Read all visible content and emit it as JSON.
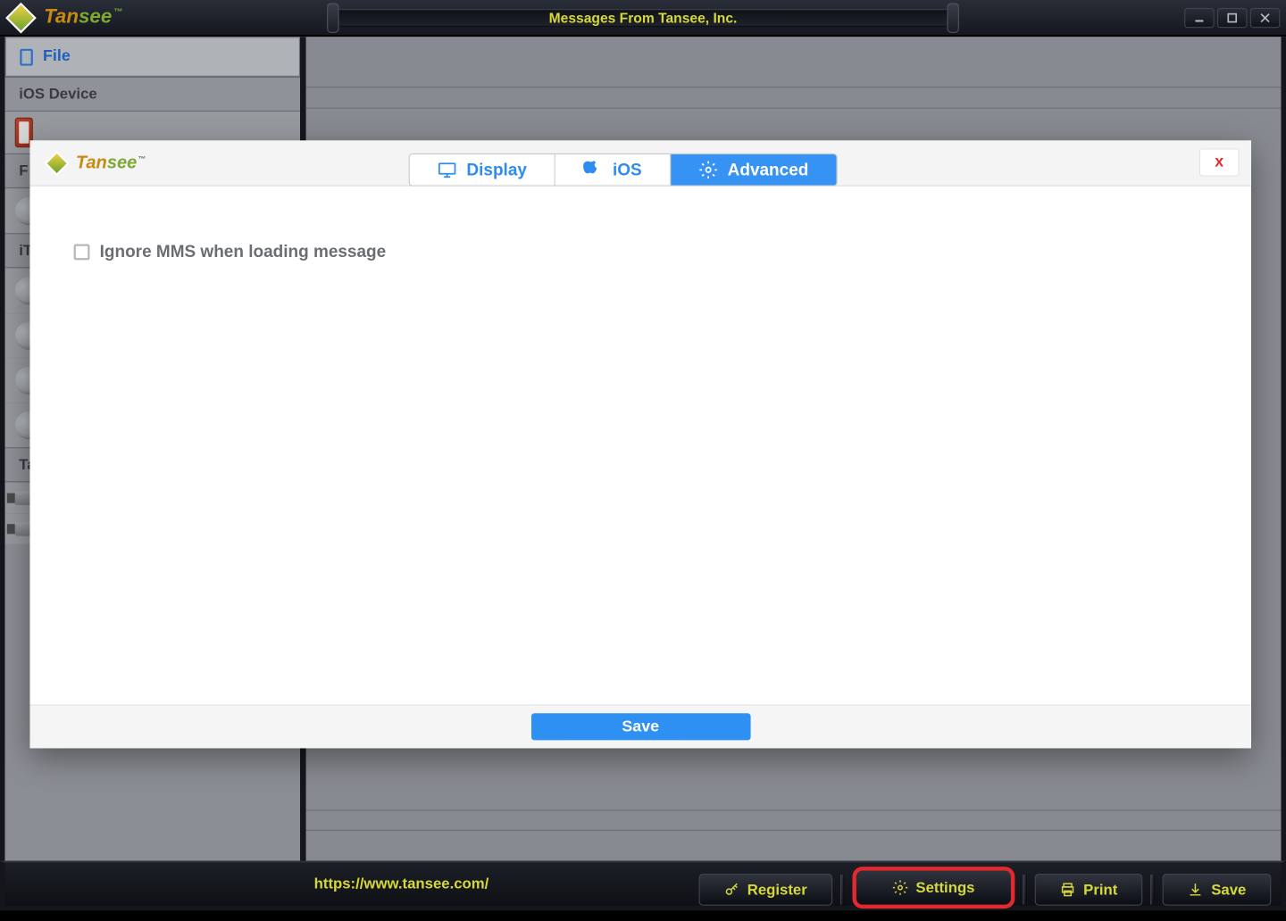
{
  "window": {
    "title": "Messages From Tansee, Inc.",
    "brand_tan": "Tan",
    "brand_see": "see",
    "brand_tm": "™"
  },
  "sidebar": {
    "file_label": "File",
    "sections": {
      "ios_device": "iOS Device",
      "features_prefix": "F",
      "itunes_prefix": "iT",
      "backup_prefix": "Ta"
    }
  },
  "modal": {
    "brand_tan": "Tan",
    "brand_see": "see",
    "brand_tm": "™",
    "tabs": {
      "display": "Display",
      "ios": "iOS",
      "advanced": "Advanced"
    },
    "close": "x",
    "option_ignore_mms": "Ignore MMS when loading message",
    "save_button": "Save"
  },
  "footer": {
    "url": "https://www.tansee.com/",
    "register": "Register",
    "settings": "Settings",
    "print": "Print",
    "save": "Save"
  }
}
